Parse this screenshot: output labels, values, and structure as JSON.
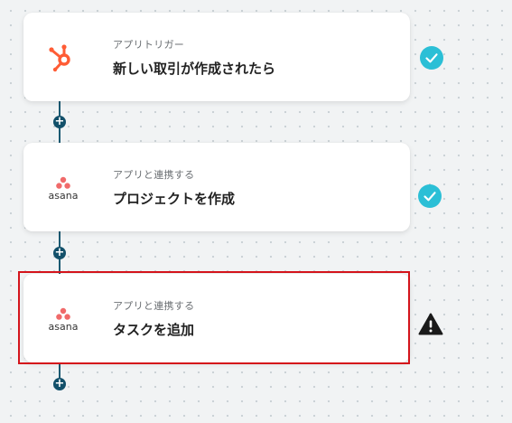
{
  "flow": {
    "steps": [
      {
        "subtitle": "アプリトリガー",
        "title": "新しい取引が作成されたら",
        "app": "hubspot-logo",
        "status": "check"
      },
      {
        "subtitle": "アプリと連携する",
        "title": "プロジェクトを作成",
        "app": "asana-logo",
        "app_text": "asana",
        "status": "check"
      },
      {
        "subtitle": "アプリと連携する",
        "title": "タスクを追加",
        "app": "asana-logo",
        "app_text": "asana",
        "status": "warning"
      }
    ],
    "add_step_label": "+"
  },
  "colors": {
    "hubspot": "#ff5c35",
    "asana": "#f06a6a",
    "check": "#2bbfd6",
    "connector": "#12506a",
    "selected_border": "#d4141b",
    "warning": "#1a1a1a"
  }
}
